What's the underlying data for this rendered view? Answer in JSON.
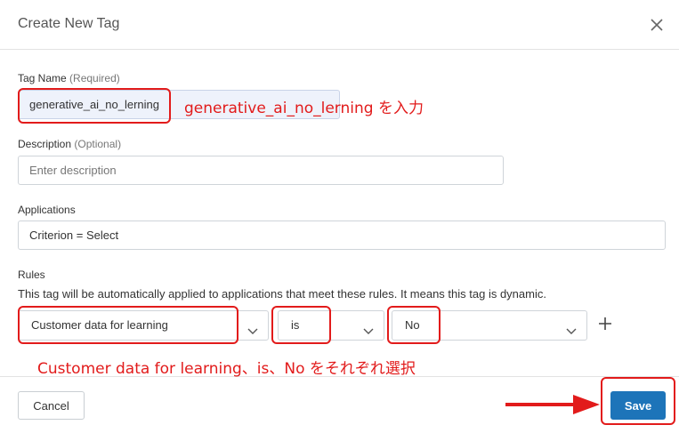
{
  "dialog": {
    "title": "Create New Tag"
  },
  "tag_name": {
    "label": "Tag Name",
    "hint": "(Required)",
    "value": "generative_ai_no_lerning"
  },
  "description": {
    "label": "Description",
    "hint": "(Optional)",
    "placeholder": "Enter description"
  },
  "applications": {
    "label": "Applications",
    "value": "Criterion = Select"
  },
  "rules": {
    "label": "Rules",
    "help": "This tag will be automatically applied to applications that meet these rules. It means this tag is dynamic.",
    "attribute": "Customer data for learning",
    "operator": "is",
    "value": "No"
  },
  "footer": {
    "cancel_label": "Cancel",
    "save_label": "Save"
  },
  "annotations": {
    "tag_name_note": "generative_ai_no_lerning を入力",
    "rules_note": "Customer data for learning、is、No をそれぞれ選択",
    "color": "#e21b1b"
  },
  "colors": {
    "primary": "#1d74b9",
    "input_highlight": "#eef2fb"
  }
}
